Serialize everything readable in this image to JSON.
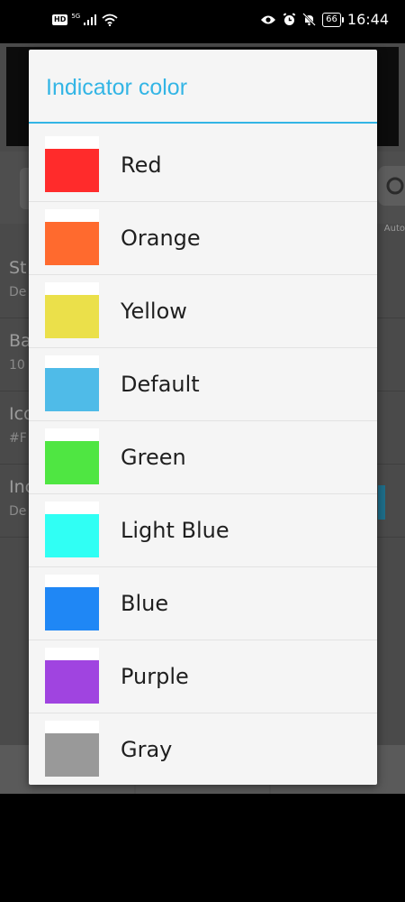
{
  "status_bar": {
    "hd_badge": "HD",
    "network": "5G",
    "battery": "66",
    "time": "16:44"
  },
  "background_app": {
    "auto_label": "Auto",
    "rows": [
      {
        "title": "St",
        "sub": "De"
      },
      {
        "title": "Ba",
        "sub": "10"
      },
      {
        "title": "Ico",
        "sub": "#F"
      },
      {
        "title": "Inc",
        "sub": "De"
      }
    ]
  },
  "dialog": {
    "title": "Indicator color",
    "accent_color": "#33b5e5",
    "options": [
      {
        "label": "Red",
        "color": "#ff2b2b"
      },
      {
        "label": "Orange",
        "color": "#ff6a2e"
      },
      {
        "label": "Yellow",
        "color": "#ebe04a"
      },
      {
        "label": "Default",
        "color": "#4fbbe8"
      },
      {
        "label": "Green",
        "color": "#4fe642"
      },
      {
        "label": "Light Blue",
        "color": "#30fff4"
      },
      {
        "label": "Blue",
        "color": "#1f87f5"
      },
      {
        "label": "Purple",
        "color": "#a044e0"
      },
      {
        "label": "Gray",
        "color": "#999999"
      }
    ]
  }
}
